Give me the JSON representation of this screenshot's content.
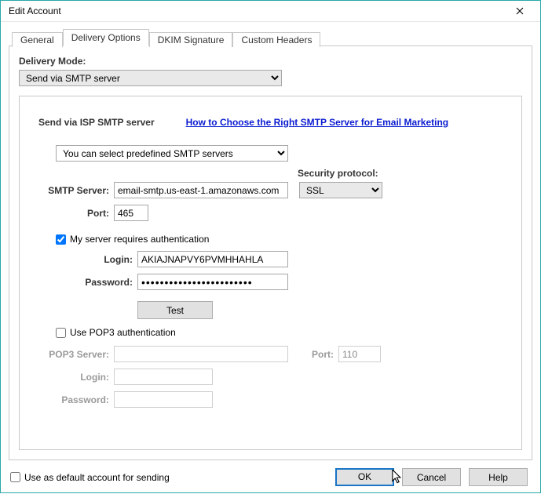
{
  "window": {
    "title": "Edit Account"
  },
  "tabs": {
    "general": "General",
    "delivery": "Delivery Options",
    "dkim": "DKIM Signature",
    "custom": "Custom Headers"
  },
  "delivery": {
    "mode_label": "Delivery Mode:",
    "mode_value": "Send via SMTP server",
    "section_title": "Send via ISP SMTP server",
    "help_link": "How to Choose the Right SMTP Server for Email Marketing",
    "predef_value": "You can select predefined SMTP servers",
    "security_label": "Security protocol:",
    "security_value": "SSL",
    "smtp_server_label": "SMTP Server:",
    "smtp_server_value": "email-smtp.us-east-1.amazonaws.com",
    "port_label": "Port:",
    "port_value": "465",
    "auth_check_label": "My server requires authentication",
    "auth_checked": true,
    "login_label": "Login:",
    "login_value": "AKIAJNAPVY6PVMHHAHLA",
    "password_label": "Password:",
    "password_value": "••••••••••••••••••••••••",
    "test_btn": "Test",
    "pop3_check_label": "Use POP3 authentication",
    "pop3_checked": false,
    "pop3_server_label": "POP3 Server:",
    "pop3_server_value": "",
    "pop3_port_label": "Port:",
    "pop3_port_value": "110",
    "pop3_login_label": "Login:",
    "pop3_login_value": "",
    "pop3_password_label": "Password:",
    "pop3_password_value": ""
  },
  "footer": {
    "default_label": "Use as default account for sending",
    "default_checked": false,
    "ok": "OK",
    "cancel": "Cancel",
    "help": "Help"
  }
}
